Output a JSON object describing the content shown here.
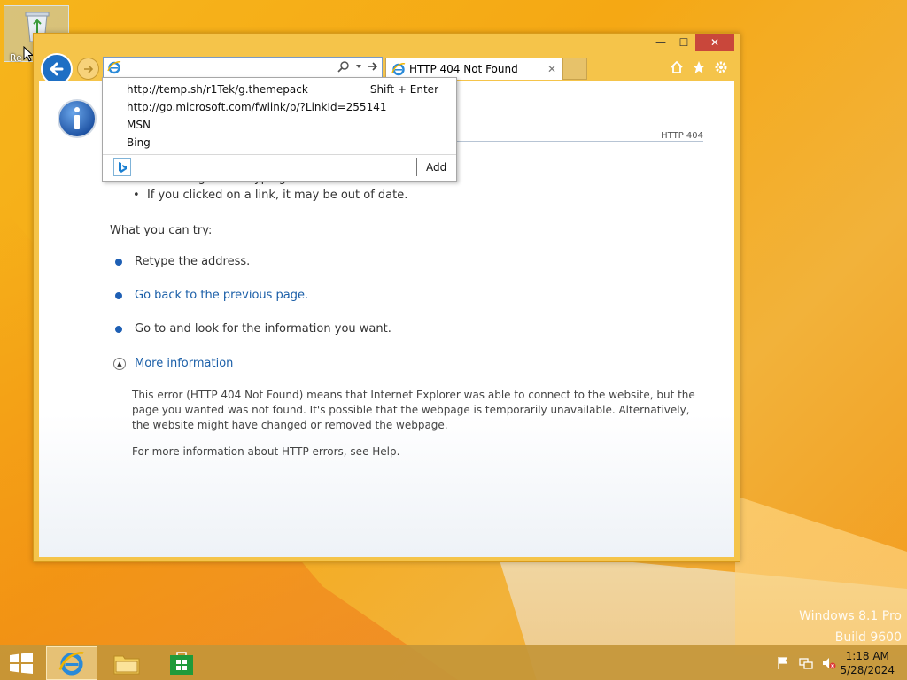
{
  "desktop": {
    "recycle_bin_label": "Re",
    "watermark": {
      "line1": "Windows 8.1 Pro",
      "line2": "Build 9600"
    }
  },
  "window": {
    "controls": {
      "minimize": "—",
      "maximize": "☐",
      "close": "✕"
    },
    "address_value": "",
    "tab": {
      "title": "HTTP 404 Not Found",
      "close": "✕"
    }
  },
  "page": {
    "http_code": "HTTP 404",
    "bullets": [
      "There might be a typing error in the address.",
      "If you clicked on a link, it may be out of date."
    ],
    "what_try": "What you can try:",
    "try_items": [
      {
        "text": "Retype the address.",
        "link": false
      },
      {
        "text": "Go back to the previous page.",
        "link": true
      },
      {
        "text": "Go to  and look for the information you want.",
        "link": false
      }
    ],
    "more_info": "More information",
    "para1": "This error (HTTP 404 Not Found) means that Internet Explorer was able to connect to the website, but the page you wanted was not found. It's possible that the webpage is temporarily unavailable. Alternatively, the website might have changed or removed the webpage.",
    "para2": "For more information about HTTP errors, see Help."
  },
  "dropdown": {
    "items": [
      "http://temp.sh/r1Tek/g.themepack",
      "http://go.microsoft.com/fwlink/p/?LinkId=255141",
      "MSN",
      "Bing"
    ],
    "shortcut": "Shift + Enter",
    "add": "Add"
  },
  "taskbar": {
    "time": "1:18 AM",
    "date": "5/28/2024"
  },
  "colors": {
    "accent": "#1e6fc4",
    "link": "#1b5fa8",
    "close_button": "#c9473b"
  }
}
